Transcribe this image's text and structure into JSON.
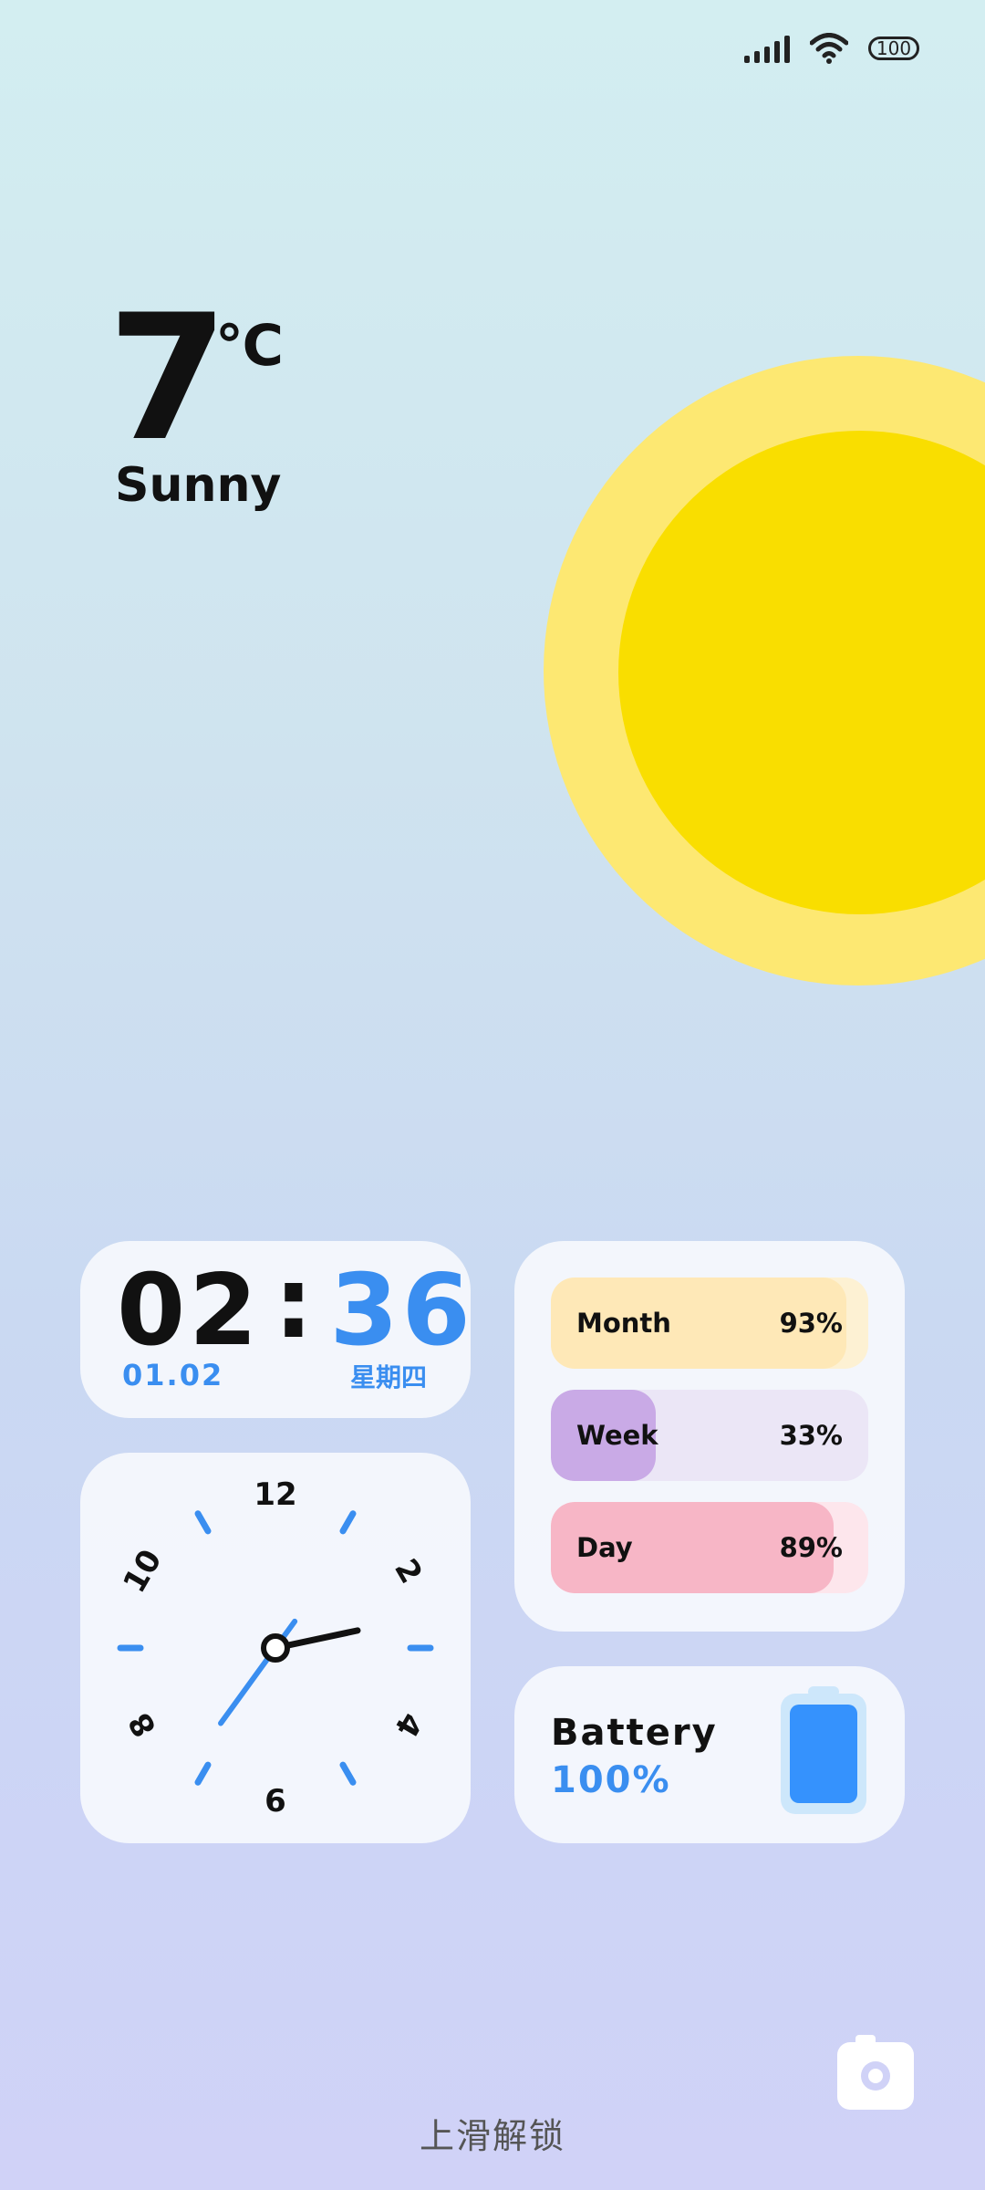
{
  "status_bar": {
    "battery_level": "100",
    "icons": [
      "signal-icon",
      "wifi-icon",
      "battery-icon"
    ]
  },
  "weather": {
    "temperature": "7",
    "unit": "℃",
    "condition": "Sunny",
    "icon": "sun-icon"
  },
  "digital_clock": {
    "hours": "02",
    "separator": ":",
    "minutes": "36",
    "date": "01.02",
    "weekday": "星期四"
  },
  "analog_clock": {
    "numerals": [
      "12",
      "2",
      "4",
      "6",
      "8",
      "10"
    ],
    "hour": 2,
    "minute": 36
  },
  "progress": {
    "items": [
      {
        "label": "Month",
        "percent_text": "93%",
        "value": 0.93
      },
      {
        "label": "Week",
        "percent_text": "33%",
        "value": 0.33
      },
      {
        "label": "Day",
        "percent_text": "89%",
        "value": 0.89
      }
    ]
  },
  "battery": {
    "label": "Battery",
    "value": "100%",
    "level": 1.0
  },
  "bottom": {
    "unlock_text": "上滑解锁",
    "camera_icon": "camera-icon"
  },
  "colors": {
    "accent": "#3a8ef0",
    "sun_outer": "#fde872",
    "sun_inner": "#f9de00",
    "month_fill": "#fee8b7",
    "week_fill": "#c9aae6",
    "day_fill": "#f7b6c6",
    "battery_fill": "#3592fd"
  }
}
